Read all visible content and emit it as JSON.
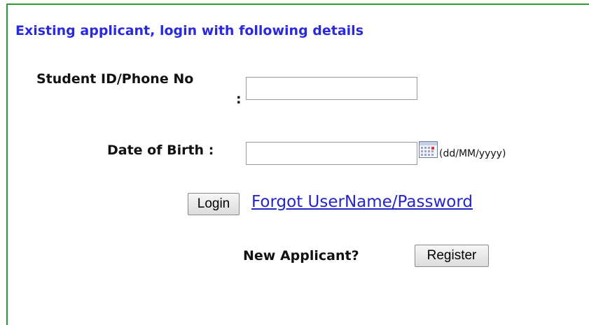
{
  "login_panel": {
    "heading": "Existing applicant, login with following details",
    "student_id_label": "Student ID/Phone No",
    "student_id_colon": ":",
    "student_id_value": "",
    "dob_label": "Date of Birth :",
    "dob_value": "",
    "dob_format_hint": "(dd/MM/yyyy)",
    "calendar_icon": "calendar-icon",
    "login_button": "Login",
    "forgot_link": "Forgot UserName/Password",
    "new_applicant_label": "New Applicant?",
    "register_button": "Register"
  },
  "colors": {
    "heading": "#2929e0",
    "link": "#2424cc",
    "panel_border": "#2e9a2e"
  }
}
